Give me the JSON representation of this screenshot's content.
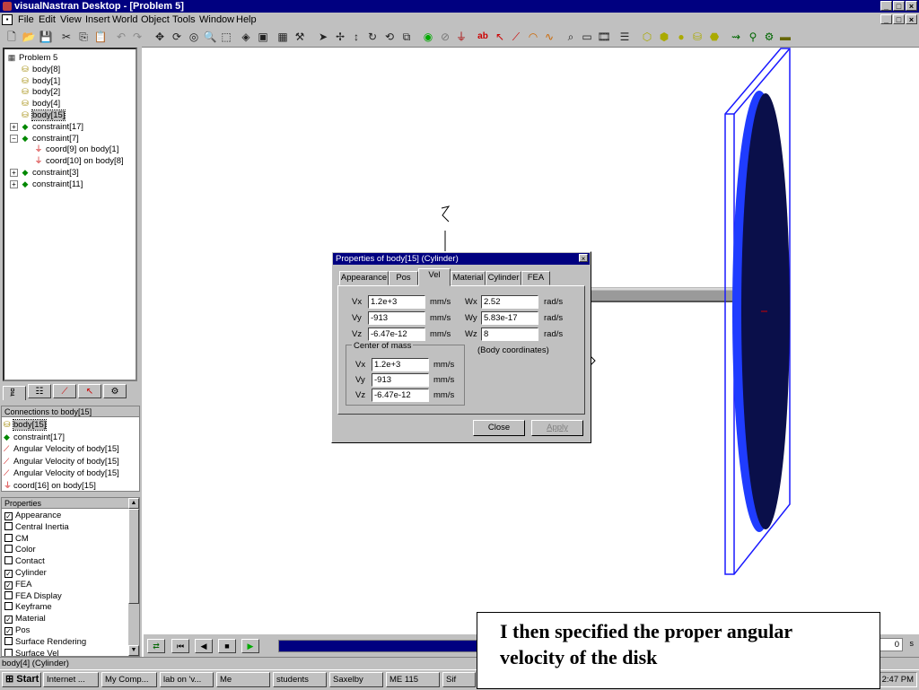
{
  "window": {
    "title": "visualNastran Desktop - [Problem 5]"
  },
  "menu": [
    "File",
    "Edit",
    "View",
    "Insert",
    "World",
    "Object",
    "Tools",
    "Window",
    "Help"
  ],
  "tree": {
    "items": [
      {
        "label": "Problem 5",
        "icon": "problem-icon",
        "indent": 0
      },
      {
        "label": "body[8]",
        "icon": "body-icon",
        "indent": 1
      },
      {
        "label": "body[1]",
        "icon": "body-icon",
        "indent": 1
      },
      {
        "label": "body[2]",
        "icon": "body-icon",
        "indent": 1
      },
      {
        "label": "body[4]",
        "icon": "body-icon",
        "indent": 1
      },
      {
        "label": "body[15]",
        "icon": "body-icon",
        "indent": 1,
        "selected": true
      },
      {
        "label": "constraint[17]",
        "icon": "constraint-icon",
        "indent": 1,
        "expander": "+"
      },
      {
        "label": "constraint[7]",
        "icon": "constraint-icon",
        "indent": 1,
        "expander": "-"
      },
      {
        "label": "coord[9] on body[1]",
        "icon": "coord-icon",
        "indent": 2
      },
      {
        "label": "coord[10] on body[8]",
        "icon": "coord-icon",
        "indent": 2
      },
      {
        "label": "constraint[3]",
        "icon": "constraint-icon",
        "indent": 1,
        "expander": "+"
      },
      {
        "label": "constraint[11]",
        "icon": "constraint-icon",
        "indent": 1,
        "expander": "+"
      }
    ]
  },
  "connections": {
    "header": "Connections to body[15]",
    "items": [
      "body[15]",
      "constraint[17]",
      "Angular Velocity of body[15]",
      "Angular Velocity of body[15]",
      "Angular Velocity of body[15]",
      "coord[16] on body[15]"
    ]
  },
  "properties": {
    "header": "Properties",
    "items": [
      {
        "label": "Appearance",
        "checked": true
      },
      {
        "label": "Central Inertia",
        "checked": false
      },
      {
        "label": "CM",
        "checked": false
      },
      {
        "label": "Color",
        "checked": false
      },
      {
        "label": "Contact",
        "checked": false
      },
      {
        "label": "Cylinder",
        "checked": true
      },
      {
        "label": "FEA",
        "checked": true
      },
      {
        "label": "FEA Display",
        "checked": false
      },
      {
        "label": "Keyframe",
        "checked": false
      },
      {
        "label": "Material",
        "checked": true
      },
      {
        "label": "Pos",
        "checked": true
      },
      {
        "label": "Surface Rendering",
        "checked": false
      },
      {
        "label": "Surface Vel",
        "checked": false
      }
    ]
  },
  "status": {
    "text": "body[4] (Cylinder)"
  },
  "dialog": {
    "title": "Properties of body[15] (Cylinder)",
    "close_glyph": "×",
    "tabs": [
      "Appearance",
      "Pos",
      "Vel",
      "Material",
      "Cylinder",
      "FEA"
    ],
    "active_tab": "Vel",
    "vel": {
      "vx": {
        "label": "Vx",
        "value": "1.2e+3",
        "unit": "mm/s"
      },
      "vy": {
        "label": "Vy",
        "value": "-913",
        "unit": "mm/s"
      },
      "vz": {
        "label": "Vz",
        "value": "-6.47e-12",
        "unit": "mm/s"
      }
    },
    "ang": {
      "wx": {
        "label": "Wx",
        "value": "2.52",
        "unit": "rad/s"
      },
      "wy": {
        "label": "Wy",
        "value": "5.83e-17",
        "unit": "rad/s"
      },
      "wz": {
        "label": "Wz",
        "value": "8",
        "unit": "rad/s"
      }
    },
    "body_coords_note": "(Body coordinates)",
    "center_of_mass": {
      "label": "Center of mass",
      "vx": {
        "label": "Vx",
        "value": "1.2e+3",
        "unit": "mm/s"
      },
      "vy": {
        "label": "Vy",
        "value": "-913",
        "unit": "mm/s"
      },
      "vz": {
        "label": "Vz",
        "value": "-6.47e-12",
        "unit": "mm/s"
      }
    },
    "buttons": {
      "close": "Close",
      "apply": "Apply"
    }
  },
  "animation": {
    "time_value": "0",
    "time_unit": "s",
    "progress_fraction": 0.97
  },
  "taskbar": {
    "start": "Start",
    "tasks": [
      "Internet ...",
      "My Comp...",
      "lab on 'v...",
      "Me",
      "students",
      "Saxelby",
      "ME 115",
      "Sif"
    ],
    "clock": "2:47 PM"
  },
  "caption": {
    "line1": "I then specified the proper angular",
    "line2": "velocity of the disk"
  },
  "colors": {
    "titlebar": "#000080",
    "disk_face": "#0a0f4a",
    "disk_rim": "#1f3cff",
    "frame": "#1a1aff",
    "shaft": "#9a9a9a"
  }
}
